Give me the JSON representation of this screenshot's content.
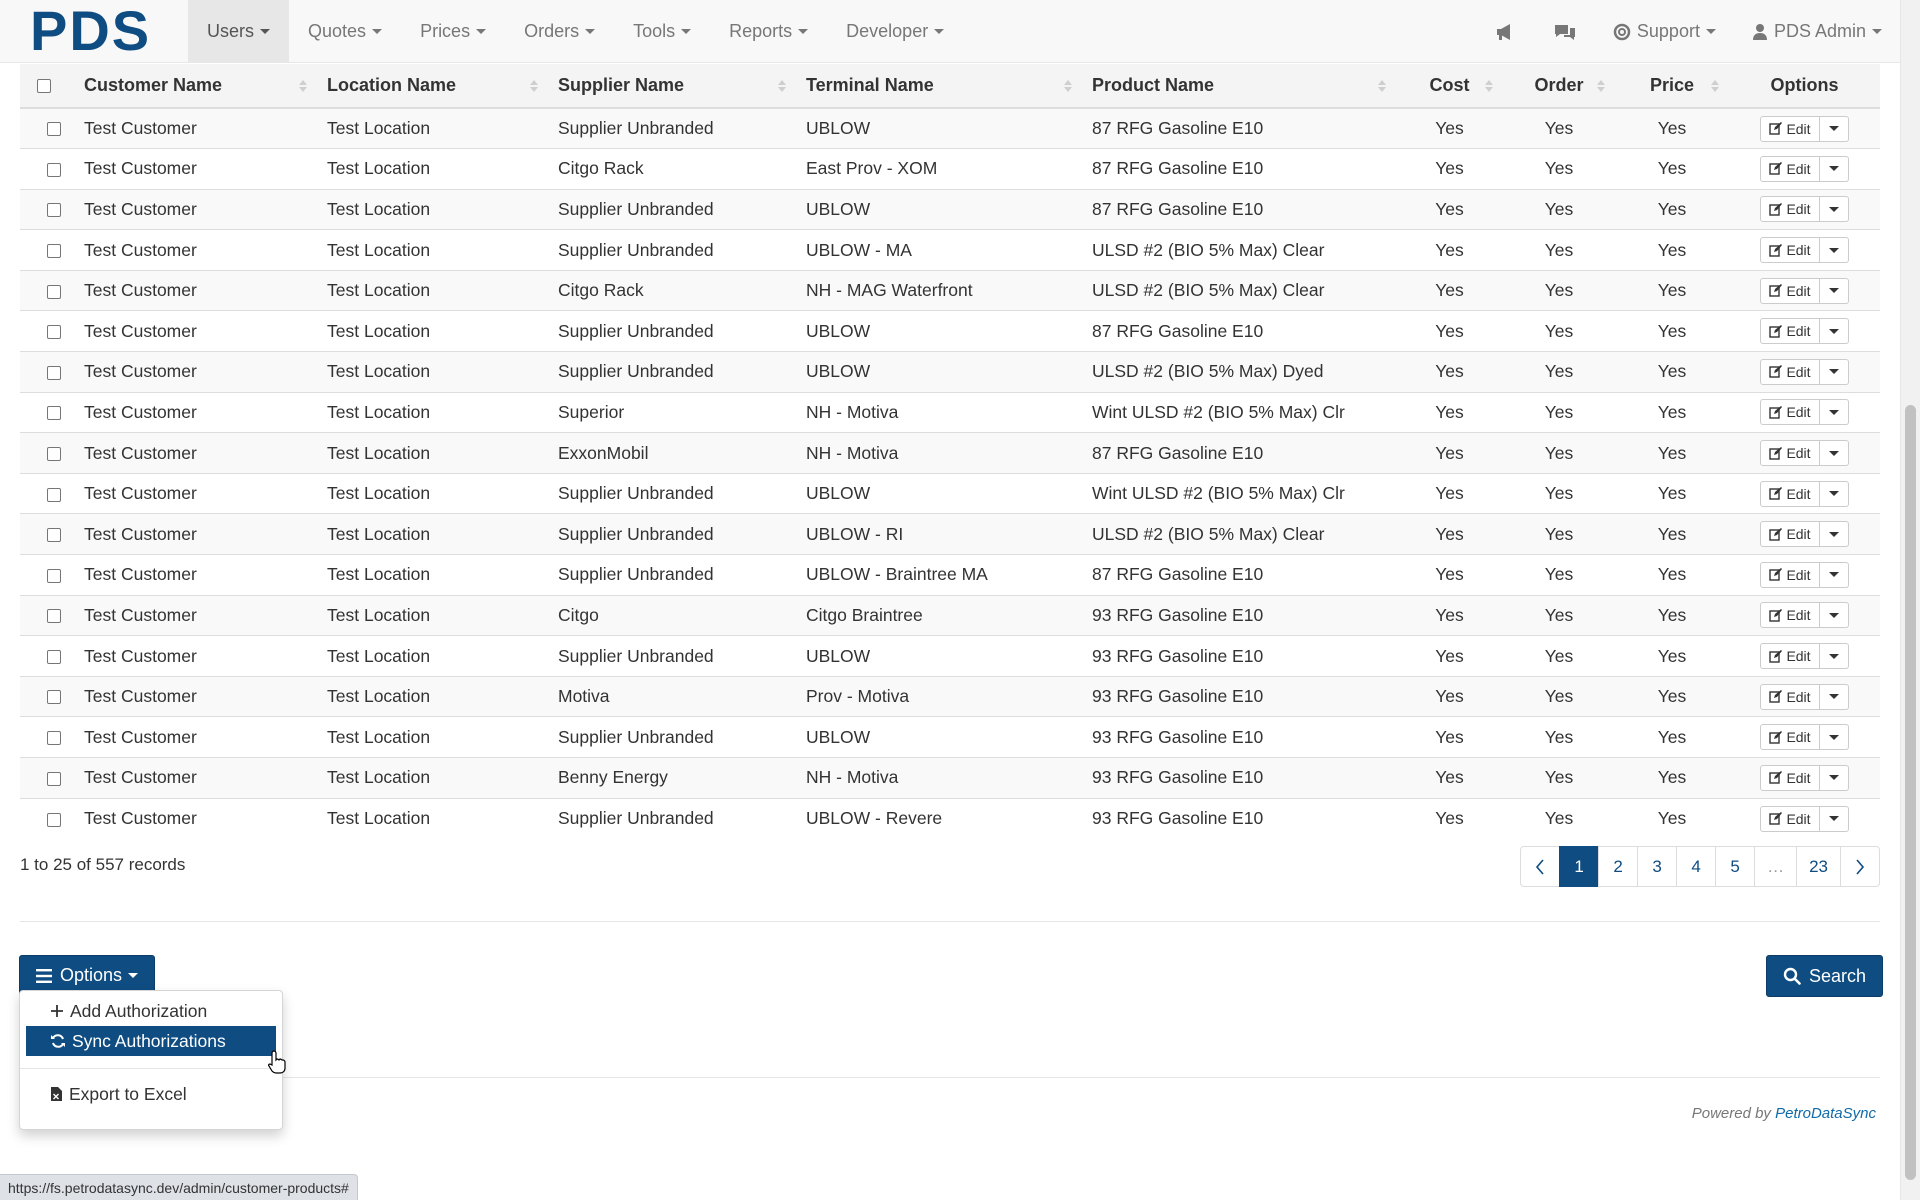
{
  "brand": "PDS",
  "nav": {
    "left": [
      {
        "label": "Users",
        "active": true
      },
      {
        "label": "Quotes"
      },
      {
        "label": "Prices"
      },
      {
        "label": "Orders"
      },
      {
        "label": "Tools"
      },
      {
        "label": "Reports"
      },
      {
        "label": "Developer"
      }
    ],
    "support_label": "Support",
    "user_label": "PDS Admin",
    "icons": [
      "bullhorn-icon",
      "comments-icon",
      "life-ring-icon",
      "user-icon"
    ]
  },
  "table": {
    "columns": [
      "Customer Name",
      "Location Name",
      "Supplier Name",
      "Terminal Name",
      "Product Name",
      "Cost",
      "Order",
      "Price",
      "Options"
    ],
    "edit_label": "Edit",
    "rows": [
      [
        "Test Customer",
        "Test Location",
        "Supplier Unbranded",
        "UBLOW",
        "87 RFG Gasoline E10",
        "Yes",
        "Yes",
        "Yes"
      ],
      [
        "Test Customer",
        "Test Location",
        "Citgo Rack",
        "East Prov - XOM",
        "87 RFG Gasoline E10",
        "Yes",
        "Yes",
        "Yes"
      ],
      [
        "Test Customer",
        "Test Location",
        "Supplier Unbranded",
        "UBLOW",
        "87 RFG Gasoline E10",
        "Yes",
        "Yes",
        "Yes"
      ],
      [
        "Test Customer",
        "Test Location",
        "Supplier Unbranded",
        "UBLOW - MA",
        "ULSD #2 (BIO 5% Max) Clear",
        "Yes",
        "Yes",
        "Yes"
      ],
      [
        "Test Customer",
        "Test Location",
        "Citgo Rack",
        "NH - MAG Waterfront",
        "ULSD #2 (BIO 5% Max) Clear",
        "Yes",
        "Yes",
        "Yes"
      ],
      [
        "Test Customer",
        "Test Location",
        "Supplier Unbranded",
        "UBLOW",
        "87 RFG Gasoline E10",
        "Yes",
        "Yes",
        "Yes"
      ],
      [
        "Test Customer",
        "Test Location",
        "Supplier Unbranded",
        "UBLOW",
        "ULSD #2 (BIO 5% Max) Dyed",
        "Yes",
        "Yes",
        "Yes"
      ],
      [
        "Test Customer",
        "Test Location",
        "Superior",
        "NH - Motiva",
        "Wint ULSD #2 (BIO 5% Max) Clr",
        "Yes",
        "Yes",
        "Yes"
      ],
      [
        "Test Customer",
        "Test Location",
        "ExxonMobil",
        "NH - Motiva",
        "87 RFG Gasoline E10",
        "Yes",
        "Yes",
        "Yes"
      ],
      [
        "Test Customer",
        "Test Location",
        "Supplier Unbranded",
        "UBLOW",
        "Wint ULSD #2 (BIO 5% Max) Clr",
        "Yes",
        "Yes",
        "Yes"
      ],
      [
        "Test Customer",
        "Test Location",
        "Supplier Unbranded",
        "UBLOW - RI",
        "ULSD #2 (BIO 5% Max) Clear",
        "Yes",
        "Yes",
        "Yes"
      ],
      [
        "Test Customer",
        "Test Location",
        "Supplier Unbranded",
        "UBLOW - Braintree MA",
        "87 RFG Gasoline E10",
        "Yes",
        "Yes",
        "Yes"
      ],
      [
        "Test Customer",
        "Test Location",
        "Citgo",
        "Citgo Braintree",
        "93 RFG Gasoline E10",
        "Yes",
        "Yes",
        "Yes"
      ],
      [
        "Test Customer",
        "Test Location",
        "Supplier Unbranded",
        "UBLOW",
        "93 RFG Gasoline E10",
        "Yes",
        "Yes",
        "Yes"
      ],
      [
        "Test Customer",
        "Test Location",
        "Motiva",
        "Prov - Motiva",
        "93 RFG Gasoline E10",
        "Yes",
        "Yes",
        "Yes"
      ],
      [
        "Test Customer",
        "Test Location",
        "Supplier Unbranded",
        "UBLOW",
        "93 RFG Gasoline E10",
        "Yes",
        "Yes",
        "Yes"
      ],
      [
        "Test Customer",
        "Test Location",
        "Benny Energy",
        "NH - Motiva",
        "93 RFG Gasoline E10",
        "Yes",
        "Yes",
        "Yes"
      ],
      [
        "Test Customer",
        "Test Location",
        "Supplier Unbranded",
        "UBLOW - Revere",
        "93 RFG Gasoline E10",
        "Yes",
        "Yes",
        "Yes"
      ]
    ]
  },
  "records_text": "1 to 25 of 557 records",
  "pagination": {
    "pages": [
      "1",
      "2",
      "3",
      "4",
      "5",
      "…",
      "23"
    ],
    "current": "1"
  },
  "options_button": "Options",
  "search_button": "Search",
  "options_menu": {
    "items": [
      "Add Authorization",
      "Sync Authorizations",
      "Export to Excel"
    ],
    "active": "Sync Authorizations"
  },
  "footer": {
    "powered_by": "Powered by",
    "powered_link": "PetroDataSync"
  },
  "status_url": "https://fs.petrodatasync.dev/admin/customer-products#",
  "colors": {
    "brand": "#0f4c81",
    "link": "#0f6aa8"
  }
}
